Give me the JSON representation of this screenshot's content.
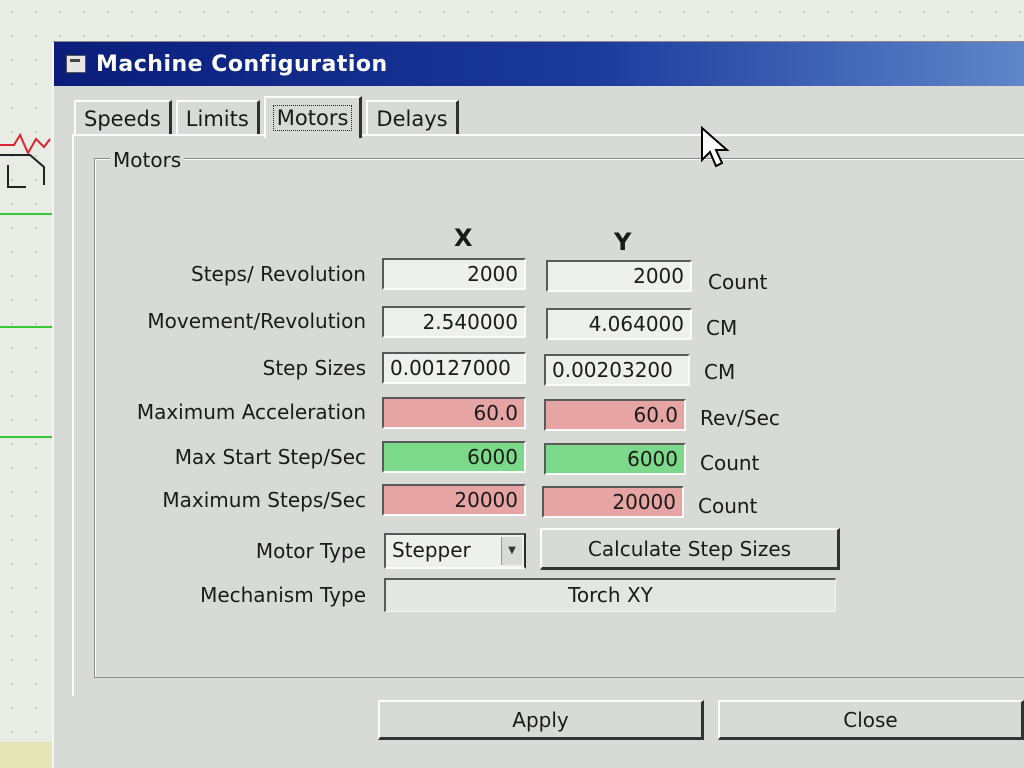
{
  "dialog": {
    "title": "Machine Configuration"
  },
  "tabs": [
    {
      "label": "Speeds"
    },
    {
      "label": "Limits"
    },
    {
      "label": "Motors",
      "active": true
    },
    {
      "label": "Delays"
    }
  ],
  "group": {
    "label": "Motors",
    "col_x": "X",
    "col_y": "Y"
  },
  "rows": [
    {
      "label": "Steps/ Revolution",
      "x": "2000",
      "y": "2000",
      "unit": "Count",
      "color": "#eef0ec"
    },
    {
      "label": "Movement/Revolution",
      "x": "2.540000",
      "y": "4.064000",
      "unit": "CM",
      "color": "#efe7d6"
    },
    {
      "label": "Step Sizes",
      "x": "0.00127000",
      "y": "0.00203200",
      "unit": "CM",
      "color": "#f6f6f6"
    },
    {
      "label": "Maximum Acceleration",
      "x": "60.0",
      "y": "60.0",
      "unit": "Rev/Sec",
      "color": "#e6a5a2"
    },
    {
      "label": "Max Start Step/Sec",
      "x": "6000",
      "y": "6000",
      "unit": "Count",
      "color": "#7dd98a"
    },
    {
      "label": "Maximum Steps/Sec",
      "x": "20000",
      "y": "20000",
      "unit": "Count",
      "color": "#e6a5a2"
    }
  ],
  "motor_type": {
    "label": "Motor Type",
    "value": "Stepper"
  },
  "calc_button": "Calculate Step Sizes",
  "mechanism": {
    "label": "Mechanism Type",
    "value": "Torch XY"
  },
  "buttons": {
    "apply": "Apply",
    "close": "Close"
  }
}
